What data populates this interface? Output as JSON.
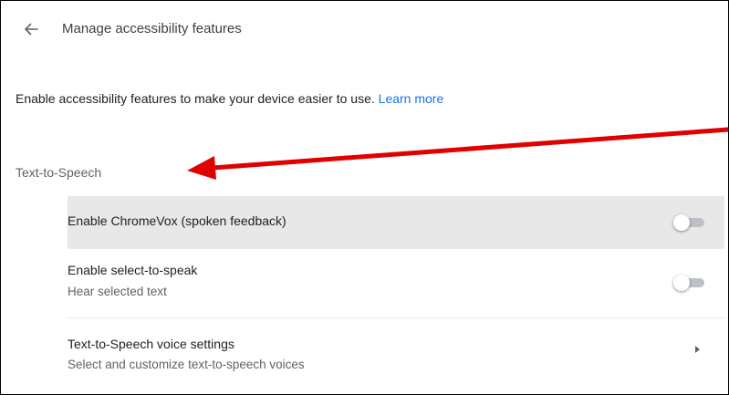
{
  "header": {
    "back_icon": "arrow-back-icon",
    "title": "Manage accessibility features"
  },
  "intro": {
    "text": "Enable accessibility features to make your device easier to use.",
    "learn_more": "Learn more",
    "link_color": "#1a73e8"
  },
  "section": {
    "heading": "Text-to-Speech"
  },
  "settings": {
    "items": [
      {
        "title": "Enable ChromeVox (spoken feedback)",
        "control": "toggle",
        "enabled": false,
        "highlighted": true
      },
      {
        "title": "Enable select-to-speak",
        "subtitle": "Hear selected text",
        "control": "toggle",
        "enabled": false
      },
      {
        "title": "Text-to-Speech voice settings",
        "subtitle": "Select and customize text-to-speech voices",
        "control": "arrow-right-icon"
      }
    ]
  },
  "annotation": {
    "type": "arrow",
    "color": "#e00000",
    "points_to": "section.heading"
  }
}
